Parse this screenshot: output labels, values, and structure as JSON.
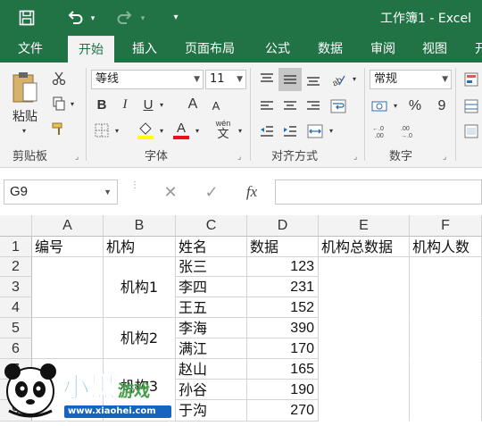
{
  "window": {
    "title": "工作簿1 - Excel"
  },
  "quick_access": {
    "save_icon": "save-icon",
    "undo_icon": "undo-icon",
    "redo_icon": "redo-icon",
    "customize_icon": "customize-icon"
  },
  "tabs": [
    {
      "label": "文件"
    },
    {
      "label": "开始",
      "active": true
    },
    {
      "label": "插入"
    },
    {
      "label": "页面布局"
    },
    {
      "label": "公式"
    },
    {
      "label": "数据"
    },
    {
      "label": "审阅"
    },
    {
      "label": "视图"
    },
    {
      "label": "开"
    }
  ],
  "ribbon": {
    "clipboard": {
      "paste_label": "粘贴",
      "group_label": "剪贴板"
    },
    "font": {
      "font_name": "等线",
      "font_size": "11",
      "bold": "B",
      "italic": "I",
      "underline": "U",
      "grow": "A",
      "shrink": "A",
      "font_color_label": "A",
      "wen_label": "wén",
      "wen_char": "文",
      "group_label": "字体"
    },
    "alignment": {
      "group_label": "对齐方式"
    },
    "number": {
      "format": "常规",
      "percent": "%",
      "comma": "9",
      "group_label": "数字"
    }
  },
  "formula_bar": {
    "name_box": "G9",
    "fx": "fx",
    "value": ""
  },
  "columns": [
    "A",
    "B",
    "C",
    "D",
    "E",
    "F"
  ],
  "rows": [
    "1",
    "2",
    "3",
    "4",
    "5",
    "6",
    "7",
    "8",
    "9"
  ],
  "headers": {
    "A1": "编号",
    "B1": "机构",
    "C1": "姓名",
    "D1": "数据",
    "E1": "机构总数据",
    "F1": "机构人数"
  },
  "names": [
    "张三",
    "李四",
    "王五",
    "李海",
    "满江",
    "赵山",
    "孙谷",
    "于沟"
  ],
  "values": [
    "123",
    "231",
    "152",
    "390",
    "170",
    "165",
    "190",
    "270"
  ],
  "institutions": [
    "机构1",
    "机构2",
    "机构3"
  ],
  "watermark": {
    "text": "小黑游戏",
    "url": "www.xiaohei.com"
  },
  "colors": {
    "excel_green": "#217346",
    "ribbon_bg": "#f3f3f3",
    "grid_line": "#d4d4d4"
  }
}
